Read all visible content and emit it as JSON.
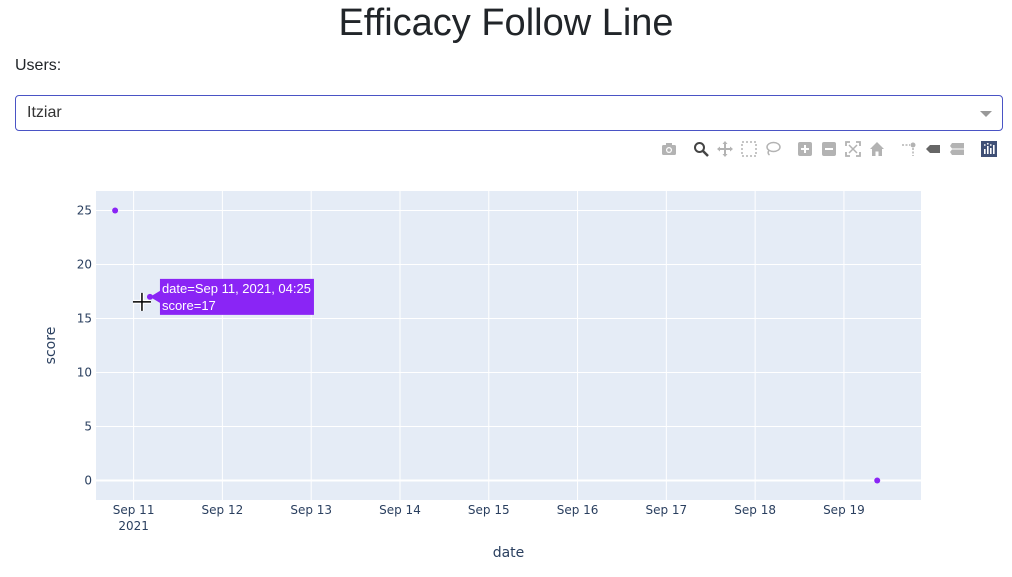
{
  "page": {
    "title": "Efficacy Follow Line",
    "users_label": "Users:",
    "selected_user": "Itziar"
  },
  "modebar": {
    "icons": [
      "camera-icon",
      "zoom-icon",
      "pan-icon",
      "box-select-icon",
      "lasso-select-icon",
      "zoom-in-icon",
      "zoom-out-icon",
      "autoscale-icon",
      "reset-axes-icon",
      "spike-lines-icon",
      "show-closest-icon",
      "compare-data-icon",
      "plotly-logo-icon"
    ]
  },
  "colors": {
    "marker": "#8a25f5",
    "plot_bg": "#e5ecf6",
    "grid": "#ffffff",
    "text": "#2a3f5f",
    "select_border": "#4a54c5"
  },
  "hover": {
    "line1": "date=Sep 11, 2021, 04:25",
    "line2": "score=17"
  },
  "chart_data": {
    "type": "scatter",
    "title": "",
    "xlabel": "date",
    "ylabel": "score",
    "x": [
      "2021-09-10 19:00",
      "2021-09-11 04:25",
      "2021-09-19 09:00"
    ],
    "y": [
      25,
      17,
      0
    ],
    "xlim": [
      "2021-09-10 13:50",
      "2021-09-19 20:50"
    ],
    "ylim": [
      -1.8,
      26.8
    ],
    "x_ticks": [
      {
        "date": "2021-09-11",
        "label": "Sep 11",
        "sublabel": "2021"
      },
      {
        "date": "2021-09-12",
        "label": "Sep 12",
        "sublabel": ""
      },
      {
        "date": "2021-09-13",
        "label": "Sep 13",
        "sublabel": ""
      },
      {
        "date": "2021-09-14",
        "label": "Sep 14",
        "sublabel": ""
      },
      {
        "date": "2021-09-15",
        "label": "Sep 15",
        "sublabel": ""
      },
      {
        "date": "2021-09-16",
        "label": "Sep 16",
        "sublabel": ""
      },
      {
        "date": "2021-09-17",
        "label": "Sep 17",
        "sublabel": ""
      },
      {
        "date": "2021-09-18",
        "label": "Sep 18",
        "sublabel": ""
      },
      {
        "date": "2021-09-19",
        "label": "Sep 19",
        "sublabel": ""
      }
    ],
    "y_ticks": [
      0,
      5,
      10,
      15,
      20,
      25
    ],
    "grid": true
  }
}
